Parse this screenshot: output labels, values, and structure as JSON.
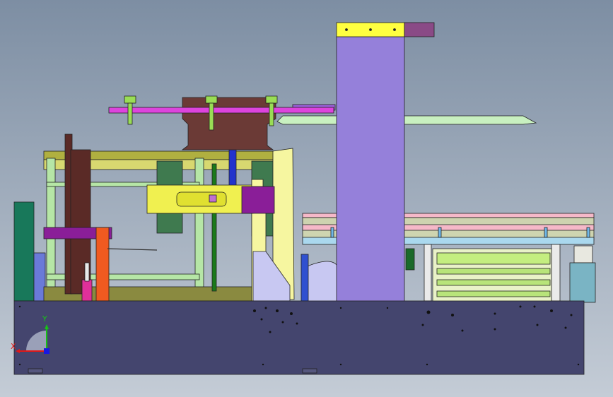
{
  "viewport": {
    "background_top": "#7d8ea3",
    "background_bottom": "#c4ccd6"
  },
  "triad": {
    "x_label": "X",
    "y_label": "Y",
    "x_color": "#e01818",
    "y_color": "#18c018",
    "z_color": "#1818e0"
  },
  "colors": {
    "base": "#44456e",
    "column": "#9580da",
    "column_cap": "#ffff40",
    "column_cap_block": "#8a4a86",
    "magenta_arm": "#dd44dd",
    "green_knob": "#99dd55",
    "brown_block": "#6b3a36",
    "brown_post": "#5a2a26",
    "olive_frame": "#b0b040",
    "light_green_frame": "#b6e6a6",
    "yellow_carriage": "#f0f050",
    "purple_block": "#8a1e98",
    "dark_green_plate": "#3f7a4f",
    "orange_post": "#f05a20",
    "blue_rail": "#2233cc",
    "pink_rail": "#f5b8c8",
    "light_cyan_rail": "#aad8ee",
    "lavender_panel": "#c8c8f2",
    "teal_panel": "#18785a",
    "steel_cyan": "#7ab4c4",
    "pale_yellow_frame": "#f6f6a0"
  }
}
